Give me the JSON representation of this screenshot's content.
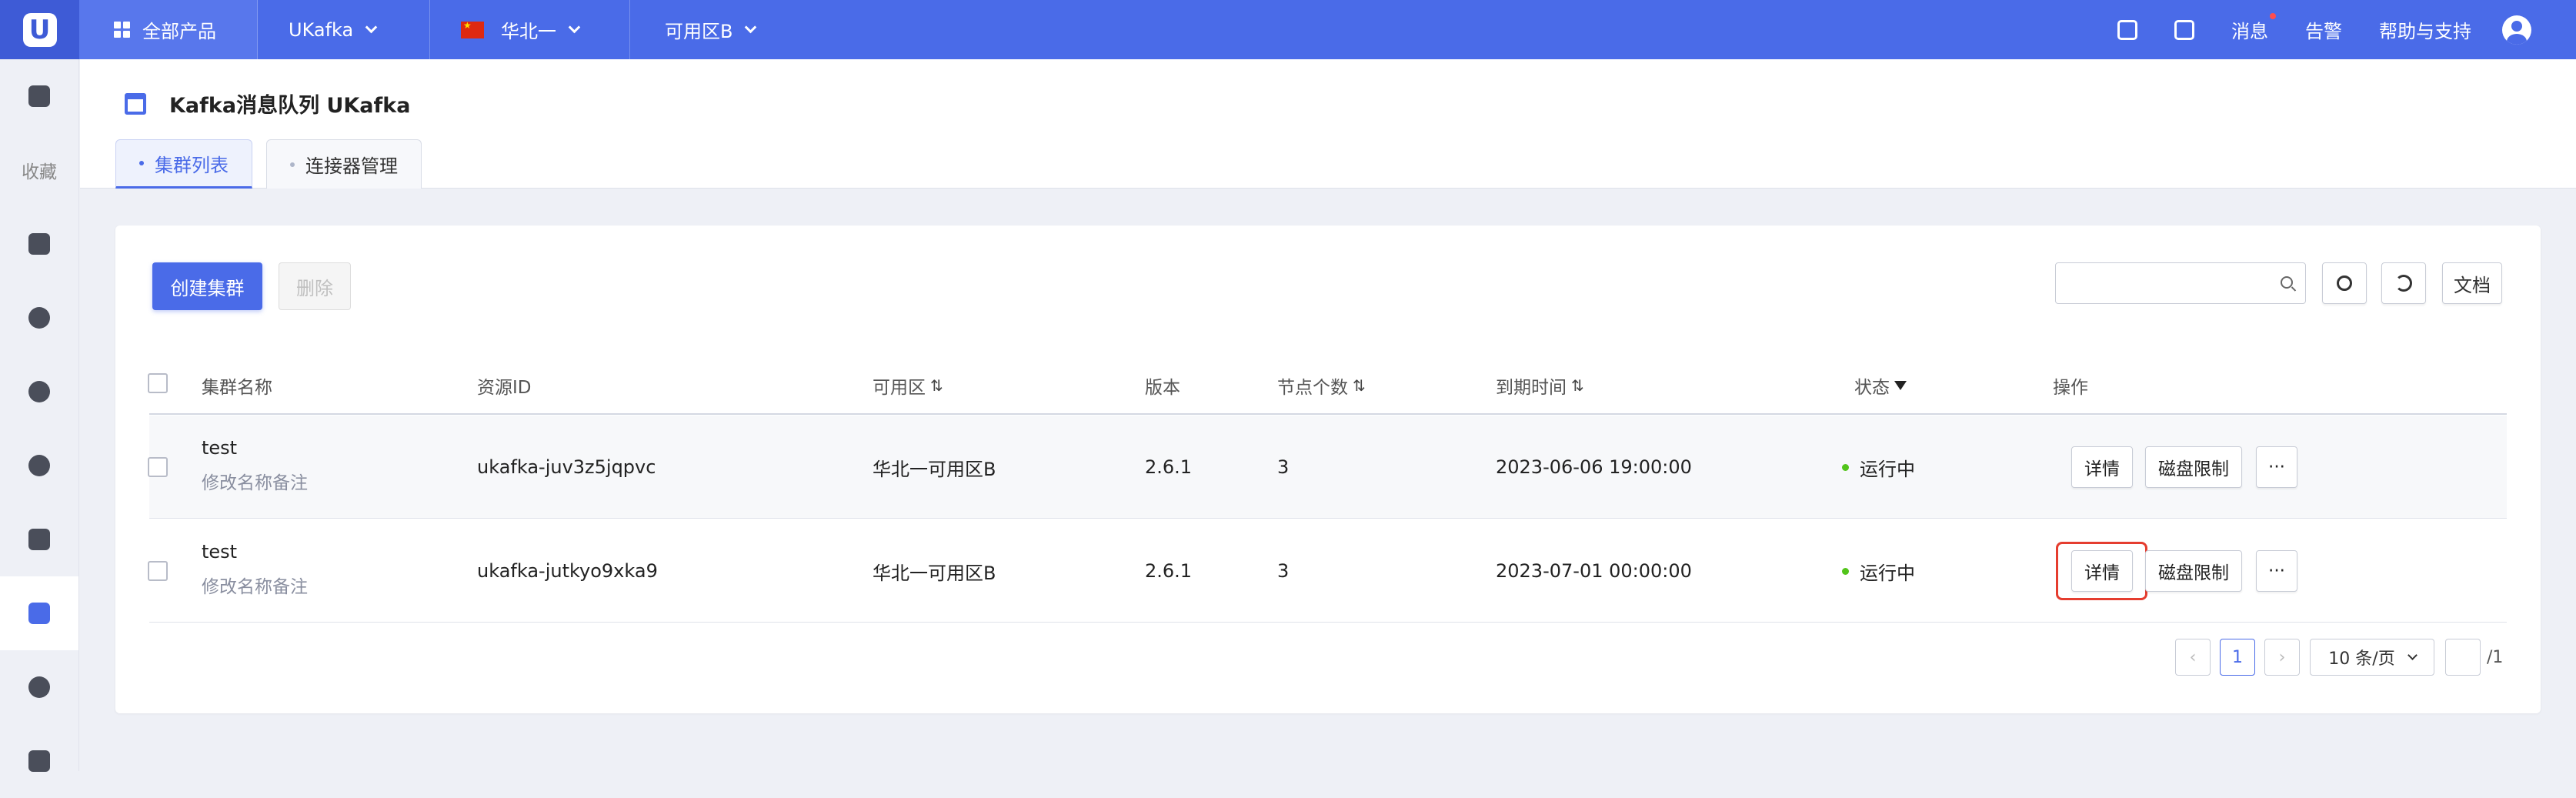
{
  "topbar": {
    "all_products": "全部产品",
    "product": "UKafka",
    "region": "华北一",
    "zone": "可用区B",
    "messages": "消息",
    "alerts": "告警",
    "help": "帮助与支持"
  },
  "sidebar": {
    "favorites_label": "收藏"
  },
  "header": {
    "title": "Kafka消息队列 UKafka",
    "tabs": [
      {
        "label": "集群列表"
      },
      {
        "label": "连接器管理"
      }
    ]
  },
  "toolbar": {
    "create_label": "创建集群",
    "delete_label": "删除",
    "docs_label": "文档",
    "search_placeholder": ""
  },
  "table": {
    "columns": {
      "name": "集群名称",
      "resource_id": "资源ID",
      "zone": "可用区",
      "version": "版本",
      "nodes": "节点个数",
      "expire": "到期时间",
      "status": "状态",
      "actions": "操作"
    },
    "rows": [
      {
        "name": "test",
        "remark": "修改名称备注",
        "resource_id": "ukafka-juv3z5jqpvc",
        "zone": "华北一可用区B",
        "version": "2.6.1",
        "nodes": "3",
        "expire": "2023-06-06 19:00:00",
        "status": "运行中",
        "detail": "详情",
        "disk_limit": "磁盘限制",
        "more": "···"
      },
      {
        "name": "test",
        "remark": "修改名称备注",
        "resource_id": "ukafka-jutkyo9xka9",
        "zone": "华北一可用区B",
        "version": "2.6.1",
        "nodes": "3",
        "expire": "2023-07-01 00:00:00",
        "status": "运行中",
        "detail": "详情",
        "disk_limit": "磁盘限制",
        "more": "···"
      }
    ]
  },
  "pagination": {
    "prev": "‹",
    "current": "1",
    "next": "›",
    "page_size": "10 条/页",
    "jump_value": "",
    "total_pages": "/1"
  },
  "colors": {
    "brand": "#4a6be8",
    "status_running": "#52c41a",
    "highlight": "#e53d2f"
  }
}
